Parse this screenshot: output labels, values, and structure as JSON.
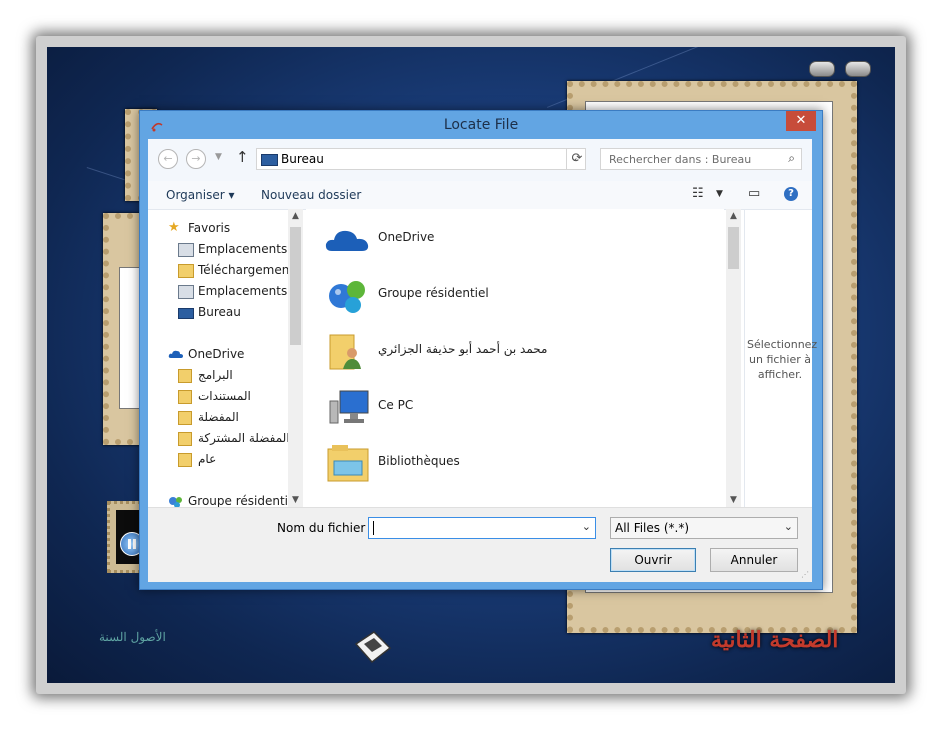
{
  "dialog": {
    "title": "Locate File",
    "close_label": "✕",
    "address": "Bureau",
    "search_placeholder": "Rechercher dans : Bureau",
    "toolbar": {
      "organize_label": "Organiser ▾",
      "new_folder_label": "Nouveau dossier"
    },
    "nav_pane": [
      {
        "label": "Favoris",
        "icon": "star-icon",
        "level": 0
      },
      {
        "label": "Emplacements ré",
        "icon": "recent-places-icon",
        "level": 1
      },
      {
        "label": "Téléchargements",
        "icon": "downloads-folder-icon",
        "level": 1
      },
      {
        "label": "Emplacements ré",
        "icon": "recent-places-icon",
        "level": 1
      },
      {
        "label": "Bureau",
        "icon": "desktop-icon",
        "level": 1
      },
      {
        "label": "OneDrive",
        "icon": "cloud-icon",
        "level": 0
      },
      {
        "label": "البرامج",
        "icon": "folder-icon",
        "level": 1
      },
      {
        "label": "المستندات",
        "icon": "folder-icon",
        "level": 1
      },
      {
        "label": "المفضلة",
        "icon": "folder-icon",
        "level": 1
      },
      {
        "label": "المفضلة المشتركة",
        "icon": "folder-icon",
        "level": 1
      },
      {
        "label": "عام",
        "icon": "folder-icon",
        "level": 1
      },
      {
        "label": "Groupe résidentiel",
        "icon": "homegroup-icon",
        "level": 0
      }
    ],
    "files": [
      {
        "name": "OneDrive",
        "icon": "cloud-icon"
      },
      {
        "name": "Groupe résidentiel",
        "icon": "homegroup-icon"
      },
      {
        "name": "محمد بن أحمد أبو حذيفة الجزائري",
        "icon": "user-folder-icon"
      },
      {
        "name": "Ce PC",
        "icon": "computer-icon"
      },
      {
        "name": "Bibliothèques",
        "icon": "libraries-icon"
      }
    ],
    "preview_text": "Sélectionnez un fichier à afficher.",
    "filename_label": "Nom du fichier :",
    "filename_value": "",
    "filter_value": "All Files (*.*)",
    "open_label": "Ouvrir",
    "cancel_label": "Annuler"
  },
  "background_app": {
    "footer_left": "الأصول السنة",
    "footer_right": "الصفحة الثانية"
  },
  "colors": {
    "dialog_frame": "#62a5e3",
    "close_button": "#c74c3a",
    "background": "#1b3f7d"
  }
}
